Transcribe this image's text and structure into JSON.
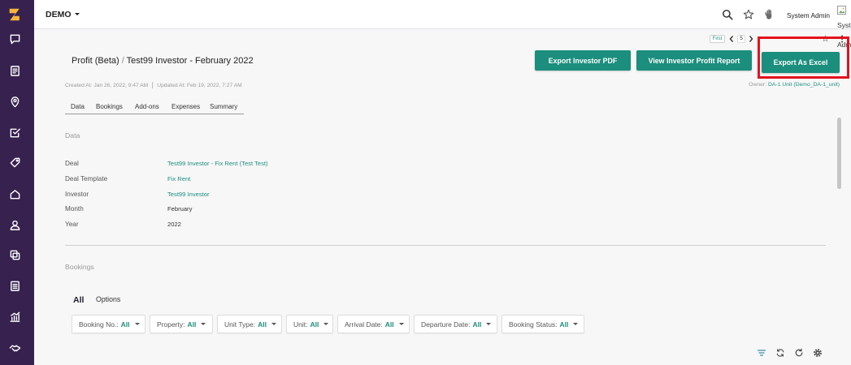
{
  "topbar": {
    "brand": "DEMO",
    "user_name": "System Admin",
    "avatar_alt": "System Admin",
    "icons": [
      "search-icon",
      "star-icon",
      "hand-icon"
    ]
  },
  "sidebar": {
    "icons": [
      "logo",
      "chat-icon",
      "document-list-icon",
      "map-pin-icon",
      "checklist-icon",
      "tag-icon",
      "home-icon",
      "user-icon",
      "copy-icon",
      "clipboard-icon",
      "bar-chart-icon",
      "handshake-icon"
    ]
  },
  "pagination": {
    "first": "First",
    "current": "5"
  },
  "page": {
    "breadcrumb_parent": "Profit (Beta)",
    "breadcrumb_separator": "/",
    "title": "Test99 Investor - February 2022",
    "created_at": "Created At: Jan 26, 2022, 9:47 AM",
    "updated_at": "Updated At: Feb 19, 2022, 7:27 AM",
    "owner_label": "Owner:",
    "owner_value": "DA-1 Unit (Demo_DA-1_unit)"
  },
  "actions": {
    "export_pdf": "Export Investor PDF",
    "view_report": "View Investor Profit Report",
    "export_excel": "Export As Excel"
  },
  "tabs": [
    "Data",
    "Bookings",
    "Add-ons",
    "Expenses",
    "Summary"
  ],
  "data_section": {
    "heading": "Data",
    "fields": [
      {
        "label": "Deal",
        "value": "Test99 Investor - Fix Rent (Test Test)",
        "is_link": true
      },
      {
        "label": "Deal Template",
        "value": "Fix Rent",
        "is_link": true
      },
      {
        "label": "Investor",
        "value": "Test99 Investor",
        "is_link": true
      },
      {
        "label": "Month",
        "value": "February",
        "is_link": false
      },
      {
        "label": "Year",
        "value": "2022",
        "is_link": false
      }
    ]
  },
  "bookings": {
    "heading": "Bookings",
    "view_label": "All",
    "options_label": "Options",
    "filters": [
      {
        "label": "Booking No.:",
        "value": "All"
      },
      {
        "label": "Property:",
        "value": "All"
      },
      {
        "label": "Unit Type:",
        "value": "All"
      },
      {
        "label": "Unit:",
        "value": "All"
      },
      {
        "label": "Arrival Date:",
        "value": "All"
      },
      {
        "label": "Departure Date:",
        "value": "All"
      },
      {
        "label": "Booking Status:",
        "value": "All"
      }
    ],
    "toolbar_icons": [
      "filter-icon",
      "sync-icon",
      "refresh-icon",
      "settings-icon"
    ]
  },
  "colors": {
    "sidebar": "#37214f",
    "accent": "#1b8e7d",
    "highlight": "#e3121b",
    "logo": "#f4b63c"
  }
}
